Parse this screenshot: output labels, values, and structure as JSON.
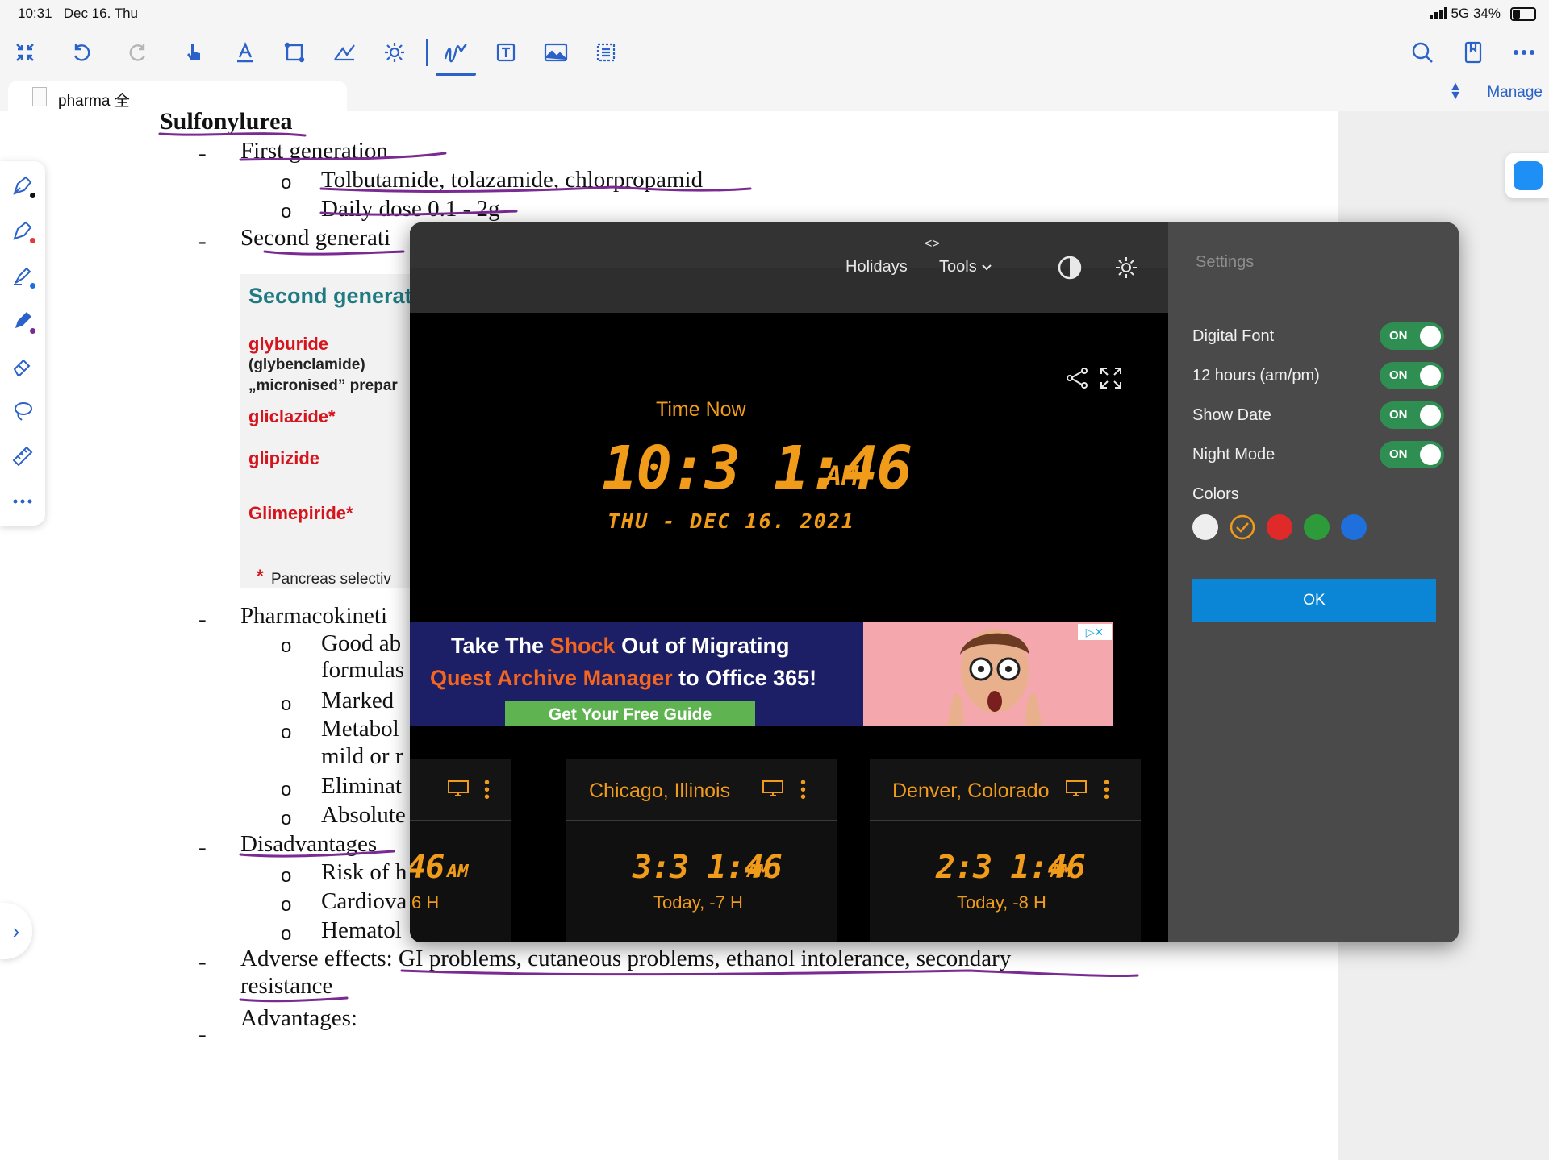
{
  "status_bar": {
    "time": "10:31",
    "date": "Dec 16. Thu",
    "network": "5G",
    "battery": "34%"
  },
  "toolbar": {
    "left_tools": [
      "collapse-icon",
      "undo-icon",
      "redo-icon",
      "hand-icon",
      "text-icon",
      "rectangle-select-icon",
      "shapes-icon",
      "settings-stamp-icon",
      "pen-icon",
      "text-box-icon",
      "image-icon",
      "outline-icon"
    ],
    "right_tools": [
      "search-icon",
      "bookmark-icon",
      "more-icon"
    ]
  },
  "tab": {
    "name": "pharma 全",
    "manage_label": "Manage"
  },
  "document": {
    "heading": "Sulfonylurea",
    "lines": [
      {
        "marker": "-",
        "text": "First generation"
      },
      {
        "marker": "o",
        "text": "Tolbutamide, tolazamide, chlorpropamid"
      },
      {
        "marker": "o",
        "text": "Daily dose 0.1 - 2g"
      },
      {
        "marker": "-",
        "text": "Second generati"
      },
      {
        "marker": "-",
        "text": "Pharmacokineti"
      },
      {
        "marker": "o",
        "text": "Good ab"
      },
      {
        "marker": "",
        "text": "formulas"
      },
      {
        "marker": "o",
        "text": "Marked"
      },
      {
        "marker": "o",
        "text": "Metabol"
      },
      {
        "marker": "",
        "text": "mild or r"
      },
      {
        "marker": "o",
        "text": "Eliminat"
      },
      {
        "marker": "o",
        "text": "Absolute"
      },
      {
        "marker": "-",
        "text": "Disadvantages"
      },
      {
        "marker": "o",
        "text": "Risk of h"
      },
      {
        "marker": "o",
        "text": "Cardiova"
      },
      {
        "marker": "o",
        "text": "Hematol"
      },
      {
        "marker": "-",
        "text": "Adverse effects: GI problems, cutaneous problems, ethanol intolerance, secondary"
      },
      {
        "marker": "",
        "text": "resistance"
      },
      {
        "marker": "-",
        "text": "Advantages:"
      }
    ],
    "figure": {
      "title": "Second generat",
      "items": [
        "glyburide",
        "(glybenclamide)",
        "„micronised” prepar",
        "gliclazide*",
        "glipizide",
        "Glimepiride*"
      ],
      "footnote_star": "*",
      "footnote": "Pancreas selectiv"
    }
  },
  "clock": {
    "header": {
      "code_label": "<>",
      "holidays": "Holidays",
      "tools": "Tools"
    },
    "time_now_label": "Time Now",
    "main_time": "10:3 1:46",
    "main_ampm": "AM",
    "main_date": "THU - DEC 16. 2021",
    "ad": {
      "line1_a": "Take The ",
      "line1_b": "Shock",
      "line1_c": " Out of Migrating",
      "line2_a": "Quest Archive Manager",
      "line2_b": " to Office 365!",
      "cta": "Get Your Free Guide",
      "adchoice": "▷✕"
    },
    "cities": [
      {
        "name": "",
        "time": "46",
        "ampm": "AM",
        "offset": "6 H"
      },
      {
        "name": "Chicago, Illinois",
        "time": "3:3 1:46",
        "ampm": "AM",
        "offset": "Today, -7 H"
      },
      {
        "name": "Denver, Colorado",
        "time": "2:3 1:46",
        "ampm": "AM",
        "offset": "Today, -8 H"
      }
    ]
  },
  "settings": {
    "title": "Settings",
    "toggles": [
      {
        "label": "Digital Font",
        "state": "ON"
      },
      {
        "label": "12 hours (am/pm)",
        "state": "ON"
      },
      {
        "label": "Show Date",
        "state": "ON"
      },
      {
        "label": "Night Mode",
        "state": "ON"
      }
    ],
    "colors_label": "Colors",
    "colors": [
      "#eeeeee",
      "#f19b1a",
      "#e02a2a",
      "#2e9b3a",
      "#1f6fdc"
    ],
    "selected_color": "#f19b1a",
    "ok_label": "OK"
  }
}
